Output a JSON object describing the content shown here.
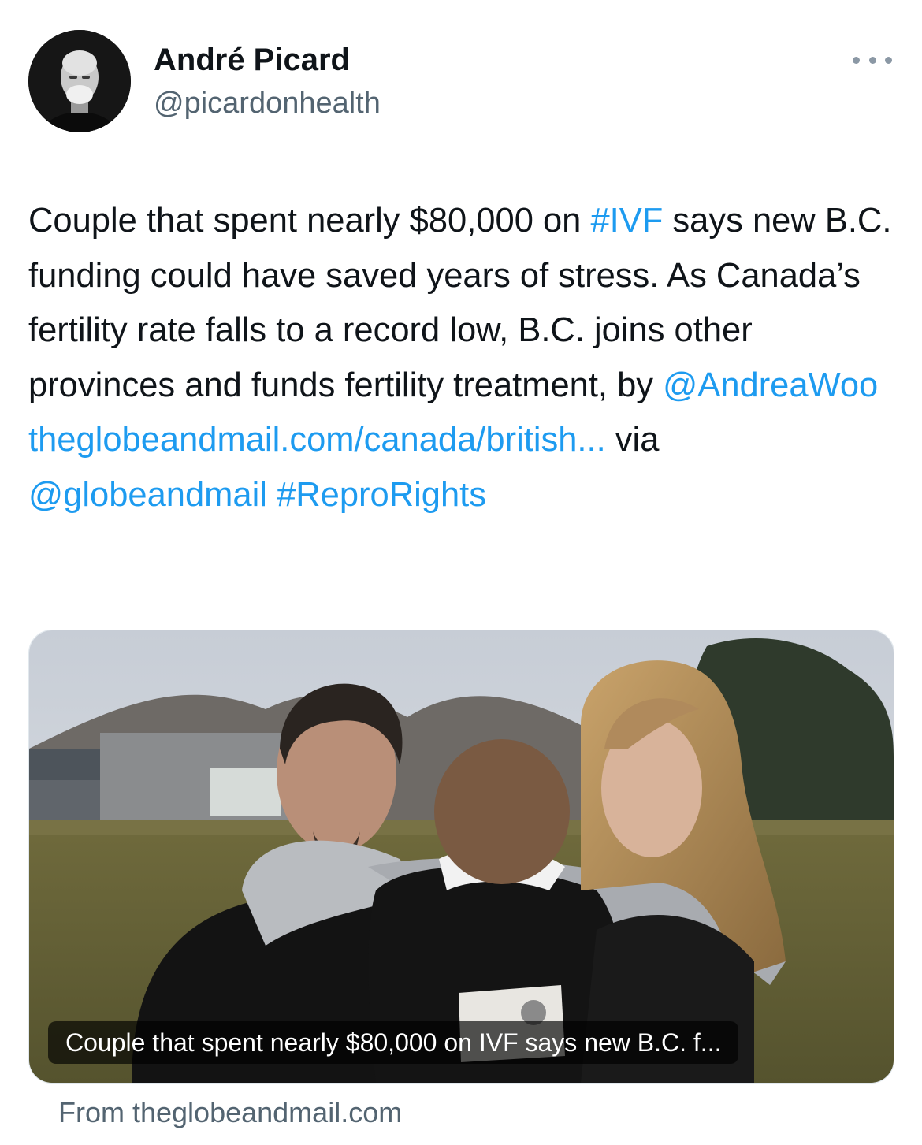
{
  "author": {
    "name": "André Picard",
    "handle": "@picardonhealth"
  },
  "icons": {
    "more": "more-options-icon",
    "avatar": "profile-avatar"
  },
  "tweet": {
    "text_part1": "Couple that spent nearly $80,000 on ",
    "hashtag_ivf": "#IVF",
    "text_part2": " says new B.C. funding could have saved years of stress. As Canada’s fertility rate falls to a record low, B.C. joins other provinces and funds fertility treatment, by ",
    "mention_author": "@AndreaWoo",
    "text_part3": " ",
    "url": "theglobeandmail.com/canada/british...",
    "text_part4": " via ",
    "mention_outlet": "@globeandmail",
    "text_part5": " ",
    "hashtag_repro": "#ReproRights"
  },
  "card": {
    "caption": "Couple that spent nearly $80,000 on IVF says new B.C. f...",
    "source": "From theglobeandmail.com"
  },
  "colors": {
    "link": "#1d9bf0",
    "text": "#0f1419",
    "secondary": "#536471"
  }
}
